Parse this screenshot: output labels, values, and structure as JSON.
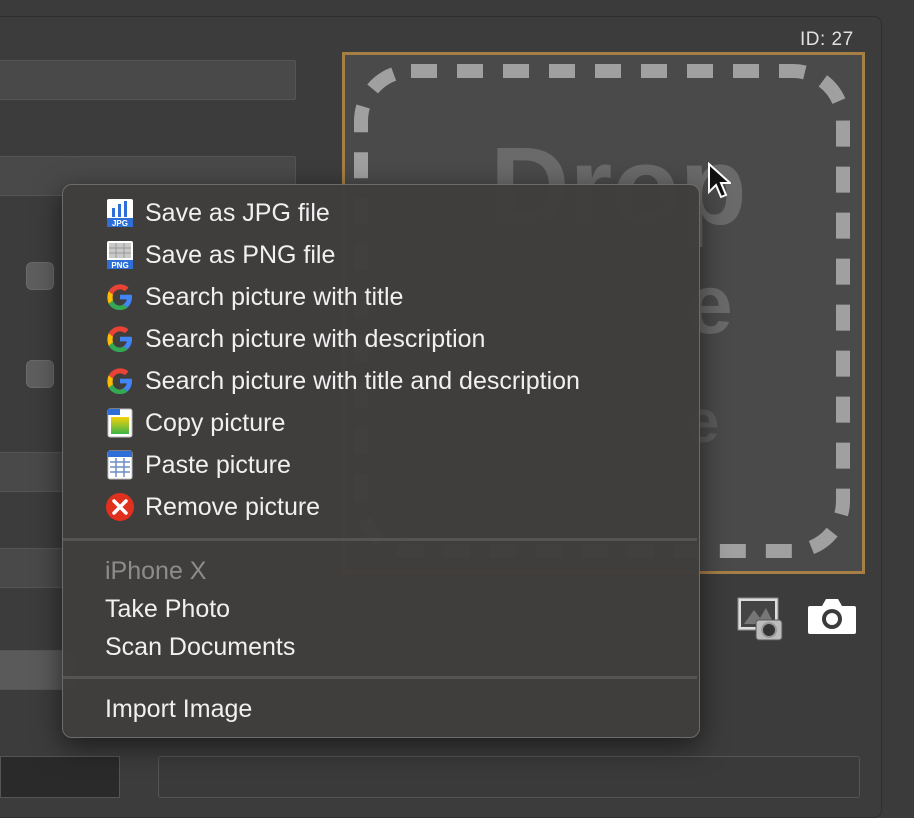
{
  "id_label": "ID: 27",
  "dropzone": {
    "line1": "Drop",
    "line2": "e",
    "line3": "e"
  },
  "context_menu": {
    "items": [
      {
        "label": "Save as JPG file",
        "icon": "jpg-file-icon"
      },
      {
        "label": "Save as PNG file",
        "icon": "png-file-icon"
      },
      {
        "label": "Search picture with title",
        "icon": "google-icon"
      },
      {
        "label": "Search picture with description",
        "icon": "google-icon"
      },
      {
        "label": "Search picture with title and description",
        "icon": "google-icon"
      },
      {
        "label": "Copy picture",
        "icon": "copy-icon"
      },
      {
        "label": "Paste picture",
        "icon": "paste-icon"
      },
      {
        "label": "Remove picture",
        "icon": "remove-icon"
      }
    ],
    "device_header": "iPhone X",
    "device_items": [
      "Take Photo",
      "Scan Documents"
    ],
    "import_label": "Import Image"
  },
  "colors": {
    "accent_border": "#a67f45",
    "remove_red": "#e0301e"
  }
}
